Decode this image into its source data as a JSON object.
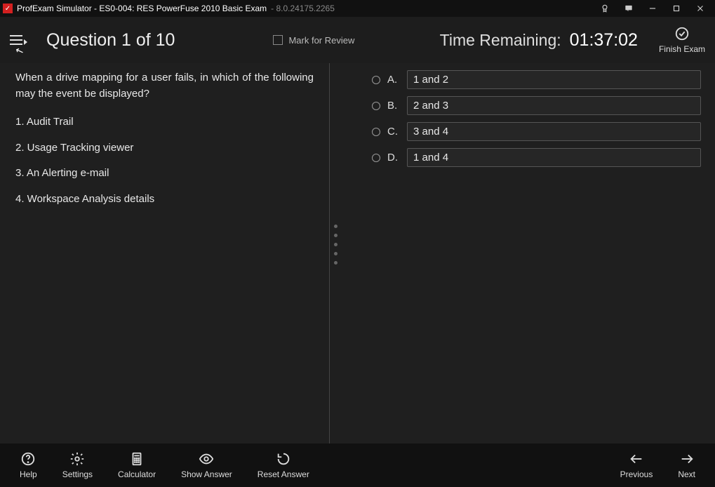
{
  "titlebar": {
    "app_title": "ProfExam Simulator - ES0-004: RES PowerFuse 2010 Basic Exam",
    "version": "- 8.0.24175.2265"
  },
  "header": {
    "question_counter": "Question 1 of 10",
    "mark_review_label": "Mark for Review",
    "time_label": "Time Remaining:",
    "time_value": "01:37:02",
    "finish_label": "Finish Exam"
  },
  "question": {
    "text": "When a drive mapping for a user fails, in which of the following may the event be displayed?",
    "opts": {
      "o1": "1. Audit Trail",
      "o2": "2. Usage Tracking viewer",
      "o3": "3. An Alerting e-mail",
      "o4": "4. Workspace Analysis details"
    }
  },
  "answers": {
    "a": {
      "letter": "A.",
      "text": "1 and 2"
    },
    "b": {
      "letter": "B.",
      "text": "2 and 3"
    },
    "c": {
      "letter": "C.",
      "text": "3 and 4"
    },
    "d": {
      "letter": "D.",
      "text": "1 and 4"
    }
  },
  "footer": {
    "help": "Help",
    "settings": "Settings",
    "calculator": "Calculator",
    "show_answer": "Show Answer",
    "reset_answer": "Reset Answer",
    "previous": "Previous",
    "next": "Next"
  }
}
